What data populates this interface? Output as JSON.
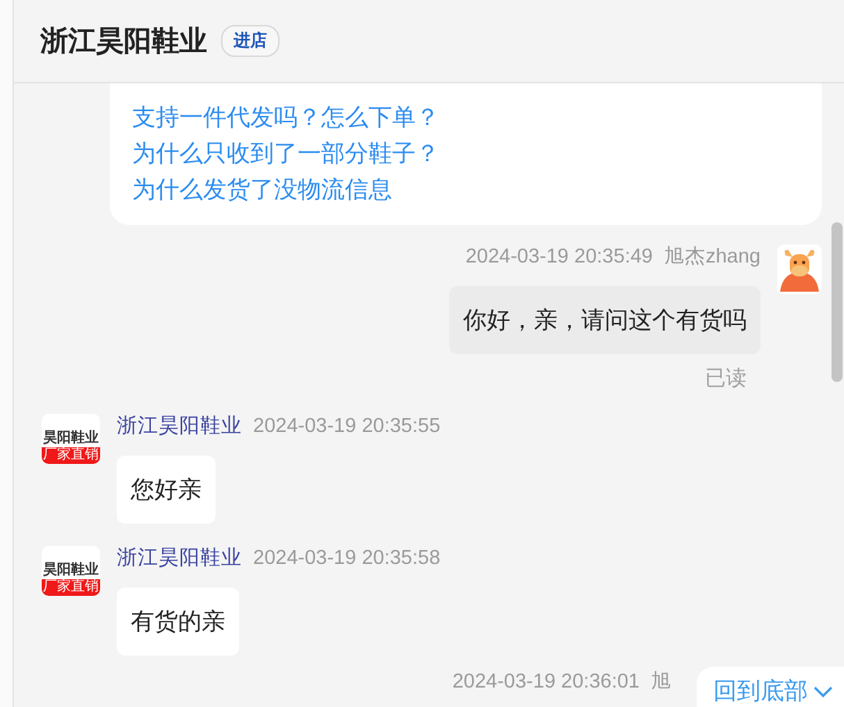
{
  "header": {
    "title": "浙江昊阳鞋业",
    "badge": "进店"
  },
  "faq": {
    "questions": [
      "支持一件代发吗？怎么下单？",
      "为什么只收到了一部分鞋子？",
      "为什么发货了没物流信息"
    ]
  },
  "messages": [
    {
      "kind": "outgoing",
      "time": "2024-03-19 20:35:49",
      "sender": "旭杰zhang",
      "text": "你好，亲，请问这个有货吗",
      "status": "已读"
    },
    {
      "kind": "incoming",
      "sender": "浙江昊阳鞋业",
      "time": "2024-03-19 20:35:55",
      "text": "您好亲",
      "avatar": {
        "name": "昊阳鞋业",
        "tag": "厂家直销"
      }
    },
    {
      "kind": "incoming",
      "sender": "浙江昊阳鞋业",
      "time": "2024-03-19 20:35:58",
      "text": "有货的亲",
      "avatar": {
        "name": "昊阳鞋业",
        "tag": "厂家直销"
      }
    },
    {
      "kind": "outgoing",
      "time": "2024-03-19 20:36:01",
      "sender": "旭"
    }
  ],
  "scroll_button": {
    "label": "回到底部"
  }
}
